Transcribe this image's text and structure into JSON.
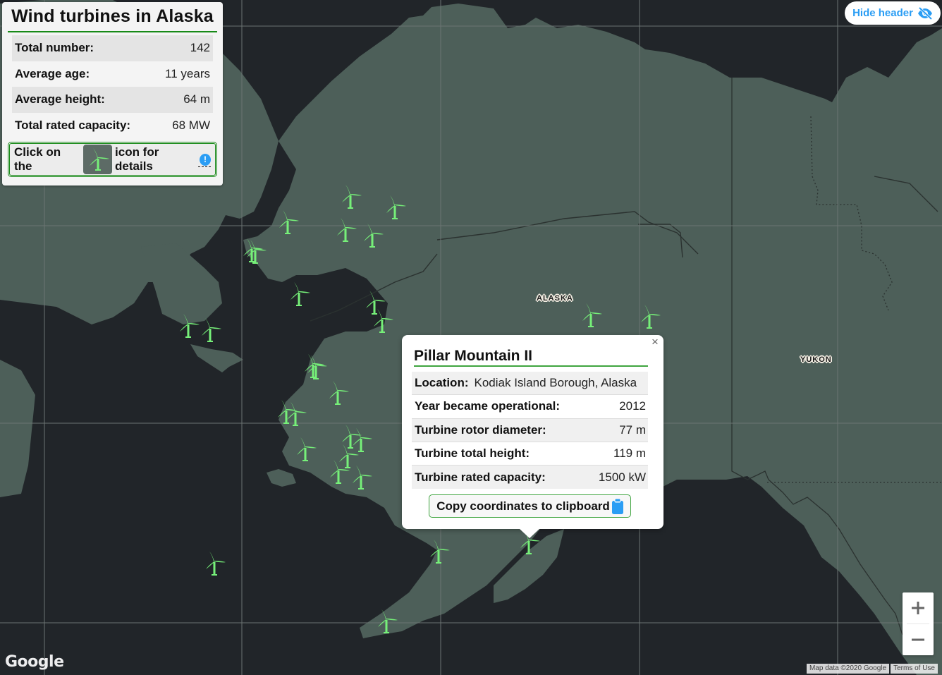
{
  "header": {
    "title": "Wind turbines in Alaska",
    "stats": [
      {
        "label": "Total number:",
        "value": "142"
      },
      {
        "label": "Average age:",
        "value": "11 years"
      },
      {
        "label": "Average height:",
        "value": "64 m"
      },
      {
        "label": "Total rated capacity:",
        "value": "68 MW"
      }
    ],
    "hint_prefix": "Click on the",
    "hint_suffix": "icon for details",
    "hint_icon": "wind-turbine-icon",
    "info_icon": "exclamation-circle-icon"
  },
  "hide_header": {
    "label": "Hide header",
    "icon": "eye-slash-icon"
  },
  "map_labels": {
    "alaska": "ALASKA",
    "yukon": "YUKON"
  },
  "popup": {
    "title": "Pillar Mountain II",
    "location_label": "Location:",
    "location_value": "Kodiak Island Borough, Alaska",
    "rows": [
      {
        "label": "Year became operational:",
        "value": "2012"
      },
      {
        "label": "Turbine rotor diameter:",
        "value": "77 m"
      },
      {
        "label": "Turbine total height:",
        "value": "119 m"
      },
      {
        "label": "Turbine rated capacity:",
        "value": "1500 kW"
      }
    ],
    "copy_label": "Copy coordinates to clipboard",
    "copy_icon": "clipboard-icon",
    "close_label": "×"
  },
  "zoom": {
    "in": "+",
    "out": "−"
  },
  "google_logo": "Google",
  "attribution": {
    "map_data": "Map data ©2020 Google",
    "terms": "Terms of Use"
  },
  "colors": {
    "land": "#4d5f59",
    "water": "#212529",
    "turbine": "#76f079",
    "accent_green": "#178a17",
    "accent_blue": "#2a9df4"
  }
}
